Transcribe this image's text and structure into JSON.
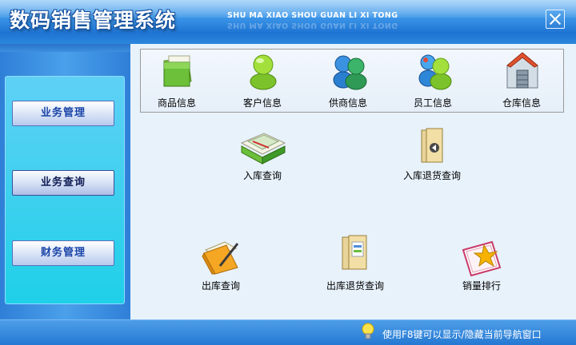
{
  "app": {
    "title": "数码销售管理系统",
    "subtitle": "SHU MA XIAO SHOU GUAN LI XI TONG"
  },
  "nav": {
    "items": [
      {
        "label": "业务管理"
      },
      {
        "label": "业务查询"
      },
      {
        "label": "财务管理"
      }
    ]
  },
  "toolbar": {
    "items": [
      {
        "label": "商品信息",
        "icon": "folder-icon"
      },
      {
        "label": "客户信息",
        "icon": "user-icon"
      },
      {
        "label": "供商信息",
        "icon": "users-group-icon"
      },
      {
        "label": "员工信息",
        "icon": "users-group-icon"
      },
      {
        "label": "仓库信息",
        "icon": "warehouse-icon"
      }
    ]
  },
  "functions": {
    "items": [
      {
        "label": "入库查询",
        "icon": "books-icon"
      },
      {
        "label": "入库退货查询",
        "icon": "folder-return-icon"
      },
      {
        "label": "出库查询",
        "icon": "folder-pencil-icon"
      },
      {
        "label": "出库退货查询",
        "icon": "document-folder-icon"
      },
      {
        "label": "销量排行",
        "icon": "chart-book-icon"
      }
    ]
  },
  "status": {
    "text": "使用F8键可以显示/隐藏当前导航窗口"
  },
  "colors": {
    "title_bar": "#2b86dc",
    "nav_panel": "#1fd0e8",
    "nav_button_text": "#1a44a8",
    "main_bg": "#e8f2fb",
    "status_bar": "#2578d2"
  }
}
